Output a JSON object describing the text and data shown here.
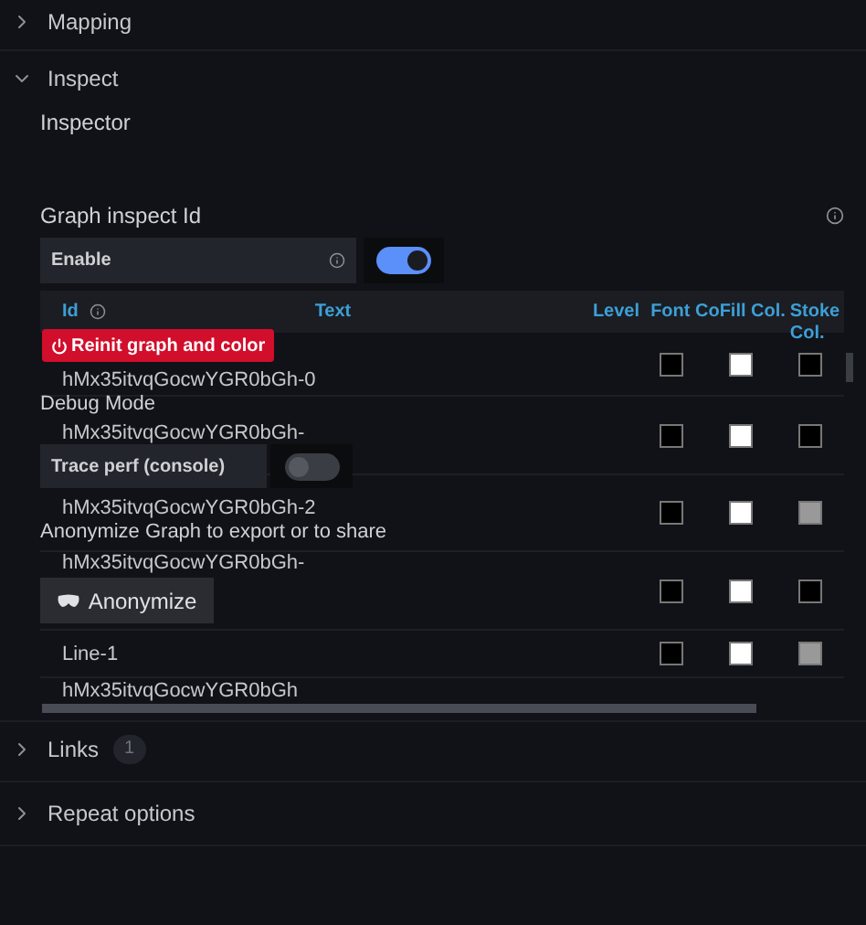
{
  "sections_top": [
    {
      "label": "Mapping",
      "expanded": false
    },
    {
      "label": "Inspect",
      "expanded": true
    }
  ],
  "inspector_title": "Inspector",
  "graph_inspect": {
    "label": "Graph inspect Id",
    "enable": {
      "label": "Enable",
      "on": true
    }
  },
  "table": {
    "columns": [
      "Id",
      "Text",
      "Level",
      "Font Co",
      "Fill Col.",
      "Stoke Col."
    ],
    "rows": [
      {
        "id": "hMx35itvqGocwYGR0bGh-0",
        "swatches": [
          {
            "color": "#000000"
          },
          {
            "color": "#ffffff"
          },
          {
            "color": "#000000"
          }
        ]
      },
      {
        "id": "hMx35itvqGocwYGR0bGh-",
        "swatches": [
          {
            "color": "#000000"
          },
          {
            "color": "#ffffff"
          },
          {
            "color": "#000000"
          }
        ]
      },
      {
        "id": "hMx35itvqGocwYGR0bGh-2",
        "swatches": [
          {
            "color": "#000000"
          },
          {
            "color": "#ffffff"
          },
          {
            "color": "#999999"
          }
        ]
      },
      {
        "id": "hMx35itvqGocwYGR0bGh-",
        "swatches": [
          {
            "color": "#000000"
          },
          {
            "color": "#ffffff"
          },
          {
            "color": "#000000"
          }
        ]
      },
      {
        "id": "Line-1",
        "swatches": [
          {
            "color": "#000000"
          },
          {
            "color": "#ffffff"
          },
          {
            "color": "#999999"
          }
        ]
      },
      {
        "id": "hMx35itvqGocwYGR0bGh"
      }
    ]
  },
  "reinit_button": "Reinit graph and color",
  "debug": {
    "label": "Debug Mode",
    "trace": {
      "label": "Trace perf (console)",
      "on": false
    }
  },
  "anonymize": {
    "label": "Anonymize Graph to export or to share",
    "button": "Anonymize"
  },
  "sections_bottom": [
    {
      "label": "Links",
      "badge": "1",
      "expanded": false
    },
    {
      "label": "Repeat options",
      "expanded": false
    }
  ]
}
